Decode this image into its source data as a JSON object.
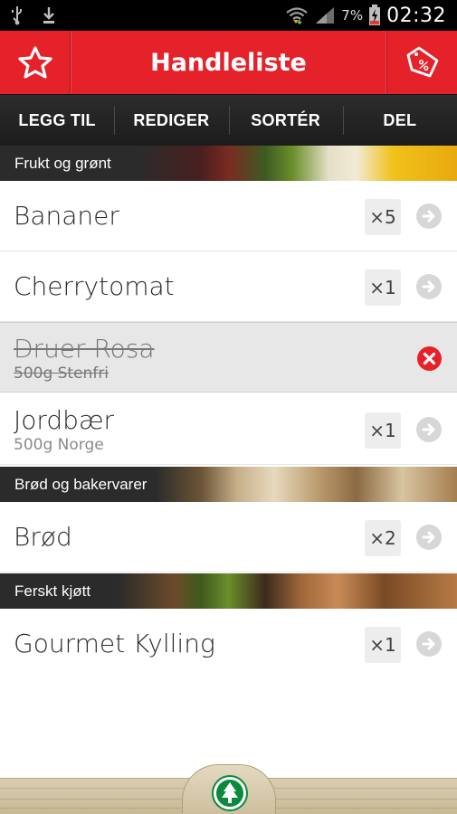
{
  "statusbar": {
    "battery_percent": "7%",
    "time": "02:32"
  },
  "header": {
    "title": "Handleliste"
  },
  "actions": [
    {
      "label": "LEGG TIL"
    },
    {
      "label": "REDIGER"
    },
    {
      "label": "SORTÉR"
    },
    {
      "label": "DEL"
    }
  ],
  "categories": [
    {
      "name": "Frukt og grønt",
      "items": [
        {
          "name": "Bananer",
          "detail": "",
          "qty": "×5",
          "checked": false
        },
        {
          "name": "Cherrytomat",
          "detail": "",
          "qty": "×1",
          "checked": false
        },
        {
          "name": "Druer Rosa",
          "detail": "500g Stenfri",
          "qty": "",
          "checked": true
        },
        {
          "name": "Jordbær",
          "detail": "500g Norge",
          "qty": "×1",
          "checked": false
        }
      ]
    },
    {
      "name": "Brød og bakervarer",
      "items": [
        {
          "name": "Brød",
          "detail": "",
          "qty": "×2",
          "checked": false
        }
      ]
    },
    {
      "name": "Ferskt kjøtt",
      "items": [
        {
          "name": "Gourmet Kylling",
          "detail": "",
          "qty": "×1",
          "checked": false
        }
      ]
    }
  ],
  "icons": {
    "favorites": "star-outline-icon",
    "offers": "price-tag-percent-icon",
    "go": "arrow-right-circle-icon",
    "remove": "remove-circle-icon",
    "home": "spar-logo-icon"
  },
  "colors": {
    "brand_red": "#e5212a",
    "actionbar_dark": "#242424",
    "remove_red": "#e8202a",
    "logo_green": "#0a8a3a"
  }
}
